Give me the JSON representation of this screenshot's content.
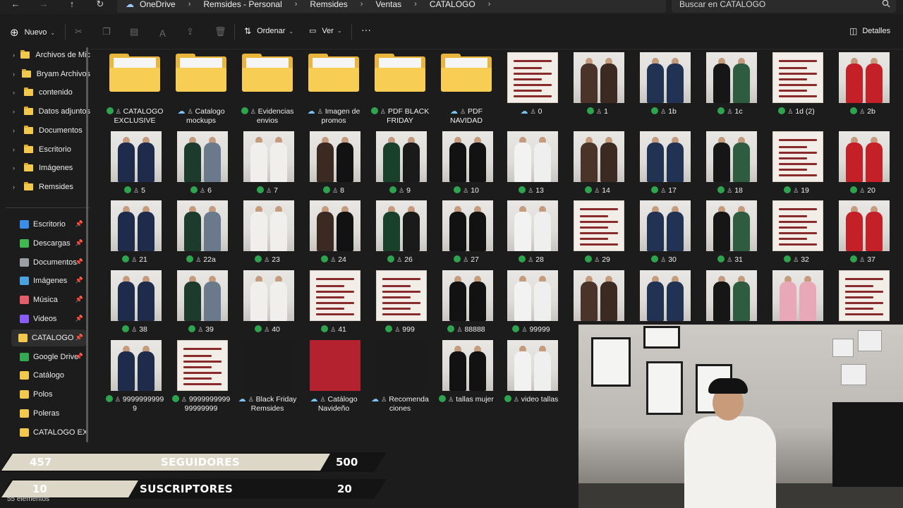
{
  "window": {
    "breadcrumb": [
      "OneDrive",
      "Remsides - Personal",
      "Remsides",
      "Ventas",
      "CATALOGO"
    ],
    "search_placeholder": "Buscar en CATALOGO"
  },
  "toolbar": {
    "new_label": "Nuevo",
    "sort_label": "Ordenar",
    "view_label": "Ver",
    "more_label": "···",
    "details_label": "Detalles"
  },
  "sidebar": {
    "tree": [
      {
        "label": "Archivos de Mic"
      },
      {
        "label": "Bryam Archivos"
      },
      {
        "label": "contenido"
      },
      {
        "label": "Datos adjuntos"
      },
      {
        "label": "Documentos"
      },
      {
        "label": "Escritorio"
      },
      {
        "label": "Imágenes"
      },
      {
        "label": "Remsides"
      }
    ],
    "quick": [
      {
        "label": "Escritorio",
        "color": "#3a8ee6"
      },
      {
        "label": "Descargas",
        "color": "#3fb950"
      },
      {
        "label": "Documentos",
        "color": "#9aa0a6"
      },
      {
        "label": "Imágenes",
        "color": "#4aa3df"
      },
      {
        "label": "Música",
        "color": "#e35d6a"
      },
      {
        "label": "Videos",
        "color": "#8a5cf6"
      },
      {
        "label": "CATALOGO",
        "color": "#f2c94c"
      },
      {
        "label": "Google Drive",
        "color": "#34a853"
      },
      {
        "label": "Catálogo",
        "color": "#f2c94c"
      },
      {
        "label": "Polos",
        "color": "#f2c94c"
      },
      {
        "label": "Poleras",
        "color": "#f2c94c"
      },
      {
        "label": "CATALOGO EXCL",
        "color": "#f2c94c"
      }
    ]
  },
  "files": [
    {
      "name": "CATALOGO\nEXCLUSIVE",
      "kind": "folder",
      "status": "synced"
    },
    {
      "name": "Catalogo\nmockups",
      "kind": "folder",
      "status": "cloud"
    },
    {
      "name": "Evidencias\nenvios",
      "kind": "folder",
      "status": "synced"
    },
    {
      "name": "Imagen de\npromos",
      "kind": "folder",
      "status": "cloud"
    },
    {
      "name": "PDF BLACK\nFRIDAY",
      "kind": "folder",
      "status": "synced"
    },
    {
      "name": "PDF\nNAVIDAD",
      "kind": "folder",
      "status": "cloud"
    },
    {
      "name": "0",
      "kind": "doc",
      "status": "cloud"
    },
    {
      "name": "1",
      "kind": "photo",
      "status": "synced"
    },
    {
      "name": "1b",
      "kind": "photo",
      "status": "synced"
    },
    {
      "name": "1c",
      "kind": "photo",
      "status": "synced"
    },
    {
      "name": "1d (2)",
      "kind": "doc",
      "status": "synced"
    },
    {
      "name": "2b",
      "kind": "photo",
      "status": "synced"
    },
    {
      "name": "5",
      "kind": "photo",
      "status": "synced"
    },
    {
      "name": "6",
      "kind": "photo",
      "status": "synced"
    },
    {
      "name": "7",
      "kind": "photo",
      "status": "synced"
    },
    {
      "name": "8",
      "kind": "photo",
      "status": "synced"
    },
    {
      "name": "9",
      "kind": "photo",
      "status": "synced"
    },
    {
      "name": "10",
      "kind": "photo",
      "status": "synced"
    },
    {
      "name": "13",
      "kind": "photo",
      "status": "synced"
    },
    {
      "name": "14",
      "kind": "photo",
      "status": "synced"
    },
    {
      "name": "17",
      "kind": "photo",
      "status": "synced"
    },
    {
      "name": "18",
      "kind": "photo",
      "status": "synced"
    },
    {
      "name": "19",
      "kind": "doc",
      "status": "synced"
    },
    {
      "name": "20",
      "kind": "photo",
      "status": "synced"
    },
    {
      "name": "21",
      "kind": "photo",
      "status": "synced"
    },
    {
      "name": "22a",
      "kind": "photo",
      "status": "synced"
    },
    {
      "name": "23",
      "kind": "photo",
      "status": "synced"
    },
    {
      "name": "24",
      "kind": "photo",
      "status": "synced"
    },
    {
      "name": "26",
      "kind": "photo",
      "status": "synced"
    },
    {
      "name": "27",
      "kind": "photo",
      "status": "synced"
    },
    {
      "name": "28",
      "kind": "photo",
      "status": "synced"
    },
    {
      "name": "29",
      "kind": "doc",
      "status": "synced"
    },
    {
      "name": "30",
      "kind": "photo",
      "status": "synced"
    },
    {
      "name": "31",
      "kind": "photo",
      "status": "synced"
    },
    {
      "name": "32",
      "kind": "doc",
      "status": "synced"
    },
    {
      "name": "37",
      "kind": "photo",
      "status": "synced"
    },
    {
      "name": "38",
      "kind": "photo",
      "status": "synced"
    },
    {
      "name": "39",
      "kind": "photo",
      "status": "synced"
    },
    {
      "name": "40",
      "kind": "photo",
      "status": "synced"
    },
    {
      "name": "41",
      "kind": "doc",
      "status": "synced"
    },
    {
      "name": "999",
      "kind": "doc",
      "status": "synced"
    },
    {
      "name": "88888",
      "kind": "photo",
      "status": "synced"
    },
    {
      "name": "99999",
      "kind": "photo",
      "status": "synced"
    },
    {
      "name": "",
      "kind": "photo",
      "status": "none"
    },
    {
      "name": "",
      "kind": "photo",
      "status": "none"
    },
    {
      "name": "",
      "kind": "photo",
      "status": "none"
    },
    {
      "name": "",
      "kind": "photo",
      "status": "none"
    },
    {
      "name": "",
      "kind": "doc",
      "status": "none"
    },
    {
      "name": "9999999999\n9",
      "kind": "photo",
      "status": "synced"
    },
    {
      "name": "9999999999\n99999999",
      "kind": "doc",
      "status": "synced"
    },
    {
      "name": "Black Friday\nRemsides",
      "kind": "dark",
      "status": "cloud"
    },
    {
      "name": "Catálogo\nNavideño",
      "kind": "red",
      "status": "cloud"
    },
    {
      "name": "Recomenda\nciones",
      "kind": "dark",
      "status": "cloud"
    },
    {
      "name": "tallas mujer",
      "kind": "photo",
      "status": "synced"
    },
    {
      "name": "video tallas",
      "kind": "photo",
      "status": "synced"
    }
  ],
  "overlay": {
    "followers": {
      "current": "457",
      "label": "SEGUIDORES",
      "goal": "500"
    },
    "subscribers": {
      "current": "10",
      "label": "SUSCRIPTORES",
      "goal": "20"
    }
  },
  "status": {
    "item_count": "55 elementos"
  }
}
